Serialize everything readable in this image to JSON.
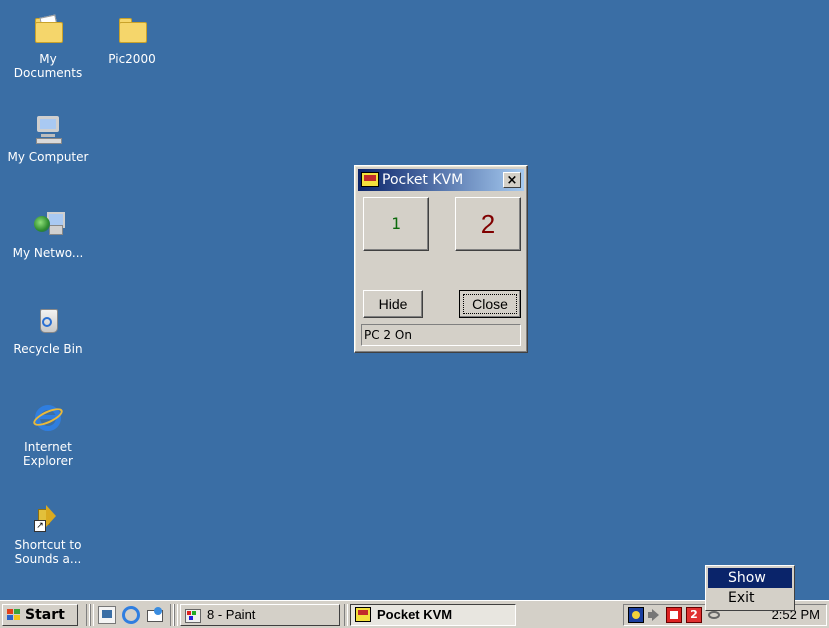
{
  "desktop": {
    "background": "#3a6ea5",
    "icons": [
      {
        "label": "My Documents"
      },
      {
        "label": "Pic2000"
      },
      {
        "label": "My Computer"
      },
      {
        "label": "My Netwo..."
      },
      {
        "label": "Recycle Bin"
      },
      {
        "label": "Internet Explorer"
      },
      {
        "label": "Shortcut to Sounds a..."
      }
    ]
  },
  "dialog": {
    "title": "Pocket KVM",
    "close_glyph": "×",
    "pc1_label": "1",
    "pc2_label": "2",
    "hide_label": "Hide",
    "close_label": "Close",
    "status": "PC 2 On"
  },
  "context_menu": {
    "items": [
      {
        "label": "Show",
        "selected": true
      },
      {
        "label": "Exit",
        "selected": false
      }
    ]
  },
  "taskbar": {
    "start_label": "Start",
    "tasks": [
      {
        "label": "8 - Paint",
        "active": false
      },
      {
        "label": "Pocket KVM",
        "active": true
      }
    ],
    "clock": "2:52 PM"
  },
  "colors": {
    "titlebar_start": "#0a246a",
    "titlebar_end": "#a6caf0",
    "button_face": "#d4d0c8",
    "pc1_text": "#0c6a0c",
    "pc2_text": "#800000"
  }
}
